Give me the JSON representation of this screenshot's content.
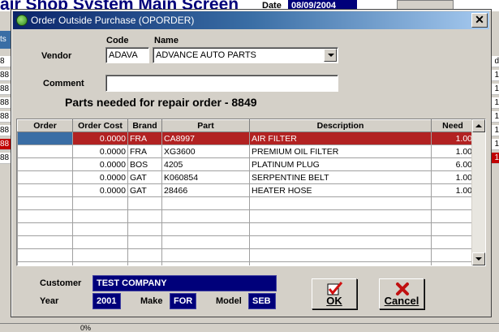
{
  "background": {
    "app_title": "air Shop System Main Screen",
    "date_label": "Date",
    "date_value": "08/09/2004",
    "left_rows": [
      "8",
      "88",
      "88",
      "88",
      "88",
      "88",
      "88",
      "88"
    ],
    "left_tab": "ts",
    "right_rows": [
      "d",
      "1",
      "1",
      "1",
      "1",
      "1",
      "1",
      "1"
    ],
    "status_pct": "0%"
  },
  "dialog": {
    "title": "Order Outside Purchase (OPORDER)",
    "close_label": "✕",
    "code_label": "Code",
    "name_label": "Name",
    "vendor_label": "Vendor",
    "vendor_code": "ADAVA",
    "vendor_name": "ADVANCE AUTO PARTS",
    "comment_label": "Comment",
    "comment_value": "",
    "heading": "Parts needed for repair order - 8849"
  },
  "grid": {
    "columns": [
      "Order",
      "Order Cost",
      "Brand",
      "Part",
      "Description",
      "Need"
    ],
    "rows": [
      {
        "order": "",
        "cost": "0.0000",
        "brand": "FRA",
        "part": "CA8997",
        "desc": "AIR FILTER",
        "need": "1.00"
      },
      {
        "order": "",
        "cost": "0.0000",
        "brand": "FRA",
        "part": "XG3600",
        "desc": "PREMIUM OIL FILTER",
        "need": "1.00"
      },
      {
        "order": "",
        "cost": "0.0000",
        "brand": "BOS",
        "part": "4205",
        "desc": "PLATINUM PLUG",
        "need": "6.00"
      },
      {
        "order": "",
        "cost": "0.0000",
        "brand": "GAT",
        "part": "K060854",
        "desc": "SERPENTINE BELT",
        "need": "1.00"
      },
      {
        "order": "",
        "cost": "0.0000",
        "brand": "GAT",
        "part": "28466",
        "desc": "HEATER HOSE",
        "need": "1.00"
      }
    ],
    "empty_rows": 7
  },
  "footer": {
    "customer_label": "Customer",
    "customer_value": "TEST COMPANY",
    "year_label": "Year",
    "year_value": "2001",
    "make_label": "Make",
    "make_value": "FOR",
    "model_label": "Model",
    "model_value": "SEB",
    "ok_label": "OK",
    "cancel_label": "Cancel"
  },
  "colors": {
    "selected_row": "#b22222",
    "value_box": "#00007a",
    "title_gradient_start": "#0a246a"
  }
}
